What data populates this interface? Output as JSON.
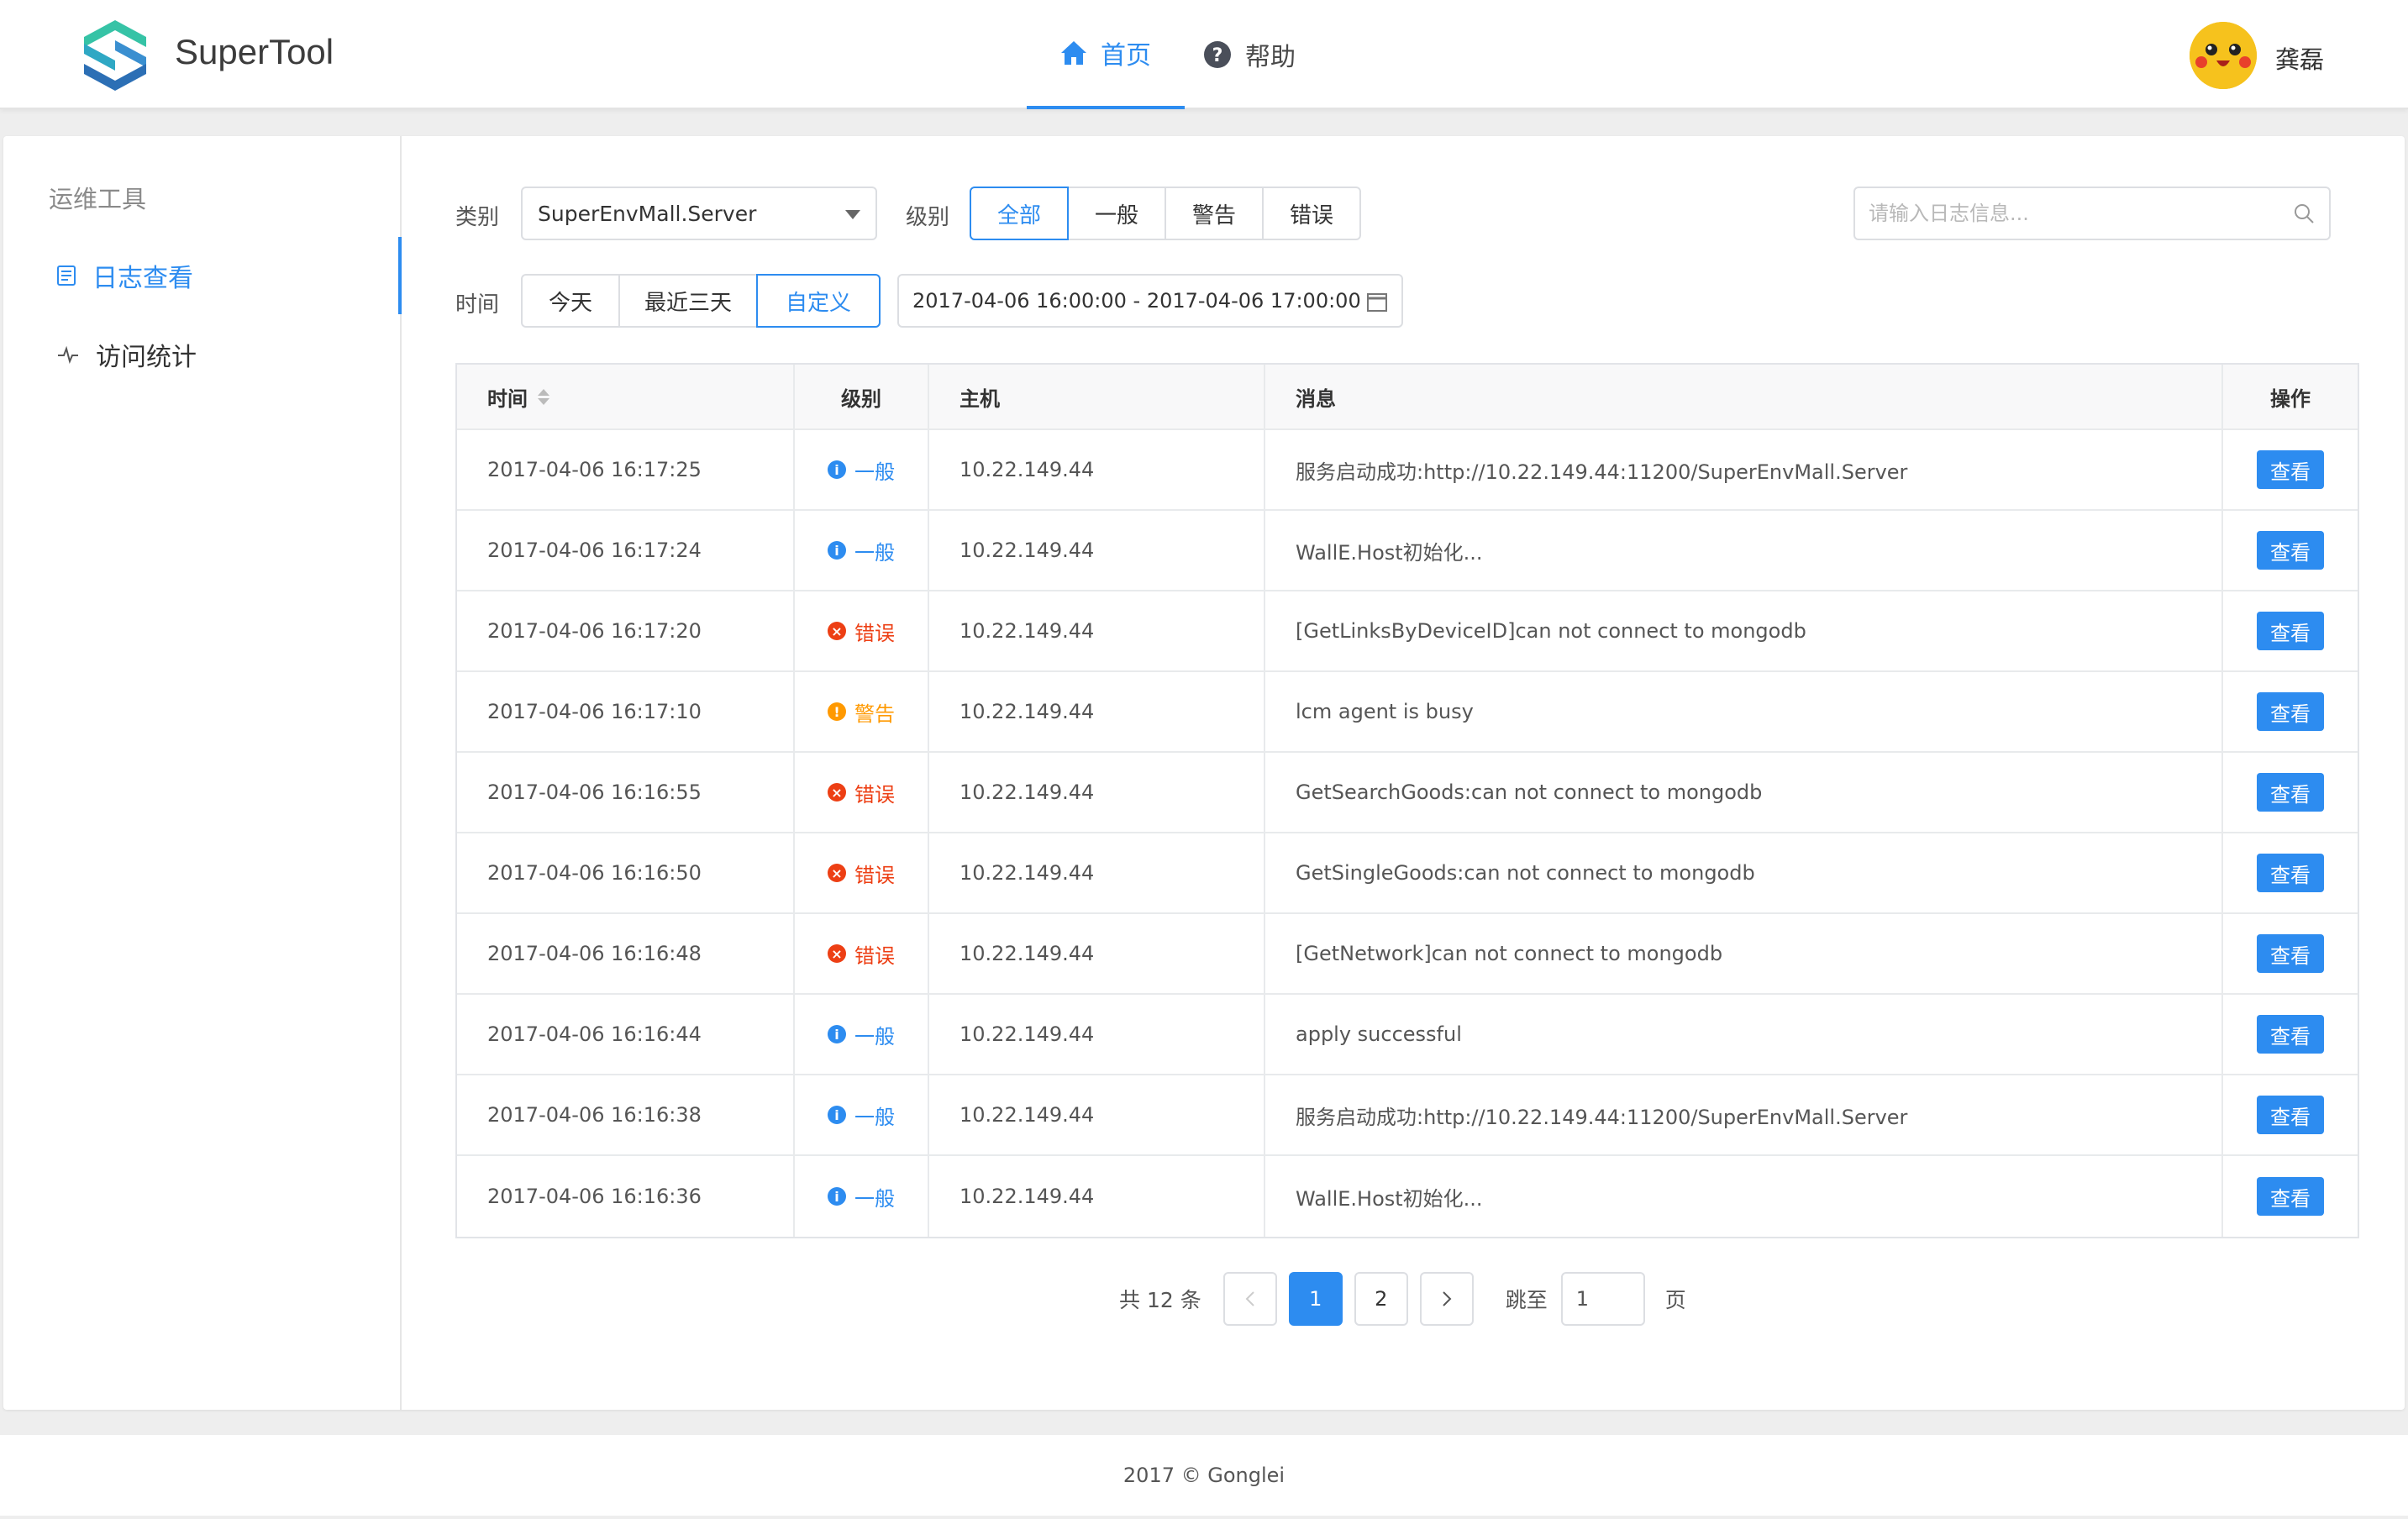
{
  "header": {
    "brand": "SuperTool",
    "nav": [
      {
        "label": "首页",
        "icon": "home-icon",
        "active": true
      },
      {
        "label": "帮助",
        "icon": "help-icon",
        "active": false
      }
    ],
    "username": "龚磊"
  },
  "sidebar": {
    "title": "运维工具",
    "items": [
      {
        "label": "日志查看",
        "icon": "log-icon",
        "active": true
      },
      {
        "label": "访问统计",
        "icon": "pulse-icon",
        "active": false
      }
    ]
  },
  "filters": {
    "category_label": "类别",
    "category_value": "SuperEnvMall.Server",
    "level_label": "级别",
    "levels": [
      "全部",
      "一般",
      "警告",
      "错误"
    ],
    "level_selected": "全部",
    "time_label": "时间",
    "time_options": [
      "今天",
      "最近三天",
      "自定义"
    ],
    "time_selected": "自定义",
    "date_range": "2017-04-06 16:00:00 - 2017-04-06 17:00:00",
    "search_placeholder": "请输入日志信息..."
  },
  "table": {
    "columns": [
      "时间",
      "级别",
      "主机",
      "消息",
      "操作"
    ],
    "action_label": "查看",
    "rows": [
      {
        "time": "2017-04-06 16:17:25",
        "level": "一般",
        "type": "info",
        "host": "10.22.149.44",
        "msg": "服务启动成功:http://10.22.149.44:11200/SuperEnvMall.Server"
      },
      {
        "time": "2017-04-06 16:17:24",
        "level": "一般",
        "type": "info",
        "host": "10.22.149.44",
        "msg": "WallE.Host初始化..."
      },
      {
        "time": "2017-04-06 16:17:20",
        "level": "错误",
        "type": "error",
        "host": "10.22.149.44",
        "msg": "[GetLinksByDeviceID]can not connect to mongodb"
      },
      {
        "time": "2017-04-06 16:17:10",
        "level": "警告",
        "type": "warn",
        "host": "10.22.149.44",
        "msg": "lcm agent is busy"
      },
      {
        "time": "2017-04-06 16:16:55",
        "level": "错误",
        "type": "error",
        "host": "10.22.149.44",
        "msg": "GetSearchGoods:can not connect to mongodb"
      },
      {
        "time": "2017-04-06 16:16:50",
        "level": "错误",
        "type": "error",
        "host": "10.22.149.44",
        "msg": "GetSingleGoods:can not connect to mongodb"
      },
      {
        "time": "2017-04-06 16:16:48",
        "level": "错误",
        "type": "error",
        "host": "10.22.149.44",
        "msg": "[GetNetwork]can not connect to mongodb"
      },
      {
        "time": "2017-04-06 16:16:44",
        "level": "一般",
        "type": "info",
        "host": "10.22.149.44",
        "msg": "apply successful"
      },
      {
        "time": "2017-04-06 16:16:38",
        "level": "一般",
        "type": "info",
        "host": "10.22.149.44",
        "msg": "服务启动成功:http://10.22.149.44:11200/SuperEnvMall.Server"
      },
      {
        "time": "2017-04-06 16:16:36",
        "level": "一般",
        "type": "info",
        "host": "10.22.149.44",
        "msg": "WallE.Host初始化..."
      }
    ]
  },
  "pagination": {
    "total_text": "共 12 条",
    "pages": [
      "1",
      "2"
    ],
    "current": "1",
    "jump_label": "跳至",
    "jump_value": "1",
    "page_suffix": "页"
  },
  "footer": {
    "text": "2017 © Gonglei"
  },
  "colors": {
    "primary": "#2d8cf0",
    "info": "#2d8cf0",
    "warn": "#ff9900",
    "error": "#ed3f14"
  }
}
